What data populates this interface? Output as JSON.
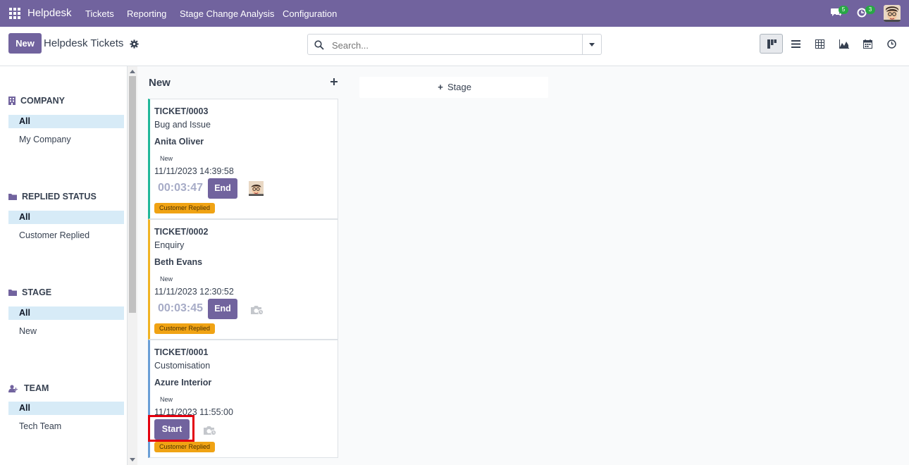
{
  "navbar": {
    "brand": "Helpdesk",
    "menus": [
      "Tickets",
      "Reporting",
      "Stage Change Analysis",
      "Configuration"
    ],
    "messages_badge": "5",
    "activities_badge": "3",
    "color": "#71639e"
  },
  "control": {
    "new_label": "New",
    "title": "Helpdesk Tickets",
    "search_placeholder": "Search...",
    "views": [
      "kanban-icon",
      "list-icon",
      "pivot-icon",
      "graph-icon",
      "calendar-icon",
      "activity-icon"
    ],
    "active_view": "kanban-icon"
  },
  "sidebar": {
    "sections": [
      {
        "title": "COMPANY",
        "icon": "building-icon",
        "items": [
          "All",
          "My Company"
        ],
        "active": 0
      },
      {
        "title": "REPLIED STATUS",
        "icon": "folder-icon",
        "items": [
          "All",
          "Customer Replied"
        ],
        "active": 0
      },
      {
        "title": "STAGE",
        "icon": "folder-icon",
        "items": [
          "All",
          "New"
        ],
        "active": 0
      },
      {
        "title": "TEAM",
        "icon": "users-icon",
        "items": [
          "All",
          "Tech Team"
        ],
        "active": 0
      }
    ]
  },
  "kanban": {
    "column_title": "New",
    "add_stage_label": "Stage",
    "tickets": [
      {
        "number": "TICKET/0003",
        "name": "Bug and Issue",
        "partner": "Anita Oliver",
        "stage": "New",
        "date": "11/11/2023 14:39:58",
        "timer": "00:03:47",
        "button": "End",
        "tag": "Customer Replied",
        "assigned": true,
        "accent": "#21b799"
      },
      {
        "number": "TICKET/0002",
        "name": "Enquiry",
        "partner": "Beth Evans",
        "stage": "New",
        "date": "11/11/2023 12:30:52",
        "timer": "00:03:45",
        "button": "End",
        "tag": "Customer Replied",
        "assigned": false,
        "accent": "#f0b323"
      },
      {
        "number": "TICKET/0001",
        "name": "Customisation",
        "partner": "Azure Interior",
        "stage": "New",
        "date": "11/11/2023 11:55:00",
        "timer": "",
        "button": "Start",
        "tag": "Customer Replied",
        "assigned": false,
        "accent": "#6a9fd6"
      }
    ]
  }
}
